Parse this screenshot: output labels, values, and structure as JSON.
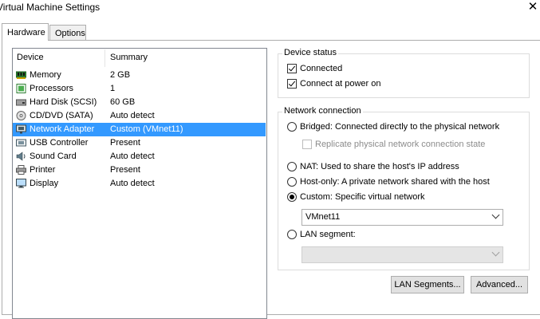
{
  "window": {
    "title": "Virtual Machine Settings",
    "close_glyph": "✕"
  },
  "tabs": [
    {
      "label": "Hardware",
      "active": true
    },
    {
      "label": "Options",
      "active": false
    }
  ],
  "device_list": {
    "headers": {
      "device": "Device",
      "summary": "Summary"
    },
    "items": [
      {
        "name": "Memory",
        "summary": "2 GB",
        "icon": "memory-icon"
      },
      {
        "name": "Processors",
        "summary": "1",
        "icon": "processor-icon"
      },
      {
        "name": "Hard Disk (SCSI)",
        "summary": "60 GB",
        "icon": "hard-disk-icon"
      },
      {
        "name": "CD/DVD (SATA)",
        "summary": "Auto detect",
        "icon": "cd-dvd-icon"
      },
      {
        "name": "Network Adapter",
        "summary": "Custom (VMnet11)",
        "icon": "network-adapter-icon",
        "selected": true
      },
      {
        "name": "USB Controller",
        "summary": "Present",
        "icon": "usb-icon"
      },
      {
        "name": "Sound Card",
        "summary": "Auto detect",
        "icon": "sound-card-icon"
      },
      {
        "name": "Printer",
        "summary": "Present",
        "icon": "printer-icon"
      },
      {
        "name": "Display",
        "summary": "Auto detect",
        "icon": "display-icon"
      }
    ]
  },
  "device_status": {
    "title": "Device status",
    "connected": {
      "label": "Connected",
      "checked": true
    },
    "connect_at_power_on": {
      "label": "Connect at power on",
      "checked": true
    }
  },
  "network_connection": {
    "title": "Network connection",
    "bridged": {
      "label": "Bridged: Connected directly to the physical network",
      "selected": false
    },
    "replicate": {
      "label": "Replicate physical network connection state",
      "checked": false,
      "enabled": false
    },
    "nat": {
      "label": "NAT: Used to share the host's IP address",
      "selected": false
    },
    "host_only": {
      "label": "Host-only: A private network shared with the host",
      "selected": false
    },
    "custom": {
      "label": "Custom: Specific virtual network",
      "selected": true
    },
    "custom_network_value": "VMnet11",
    "lan_segment": {
      "label": "LAN segment:",
      "selected": false
    },
    "lan_segment_value": ""
  },
  "buttons": {
    "lan_segments": "LAN Segments...",
    "advanced": "Advanced..."
  }
}
